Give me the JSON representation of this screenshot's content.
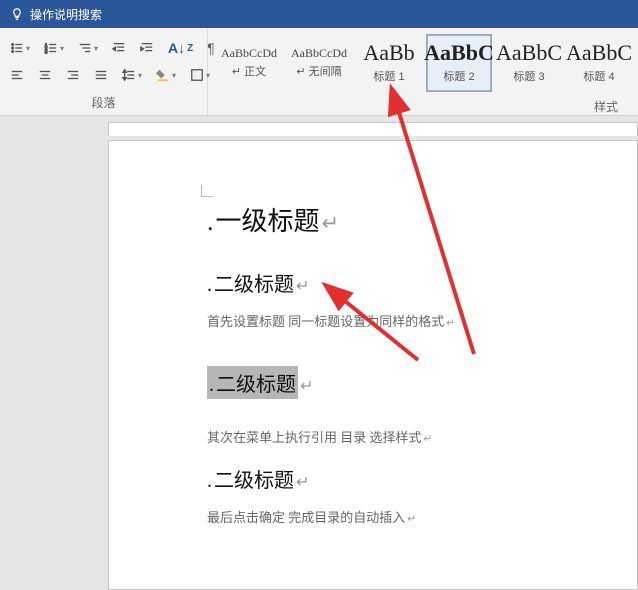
{
  "titleBar": {
    "searchText": "操作说明搜索"
  },
  "ribbon": {
    "paragraphLabel": "段落",
    "stylesLabel": "样式",
    "styles": [
      {
        "preview": "AaBbCcDd",
        "name": "↵ 正文",
        "cls": "small"
      },
      {
        "preview": "AaBbCcDd",
        "name": "↵ 无间隔",
        "cls": "small"
      },
      {
        "preview": "AaBb",
        "name": "标题 1",
        "cls": "big"
      },
      {
        "preview": "AaBbC",
        "name": "标题 2",
        "cls": "big bold",
        "selected": true
      },
      {
        "preview": "AaBbC",
        "name": "标题 3",
        "cls": "big"
      },
      {
        "preview": "AaBbC",
        "name": "标题 4",
        "cls": "big"
      }
    ]
  },
  "doc": {
    "h1": "一级标题",
    "h2a": "二级标题",
    "body1": "首先设置标题 同一标题设置为同样的格式",
    "h2b": "二级标题",
    "body2": "其次在菜单上执行引用 目录 选择样式",
    "h2c": "二级标题",
    "body3": "最后点击确定 完成目录的自动插入"
  }
}
